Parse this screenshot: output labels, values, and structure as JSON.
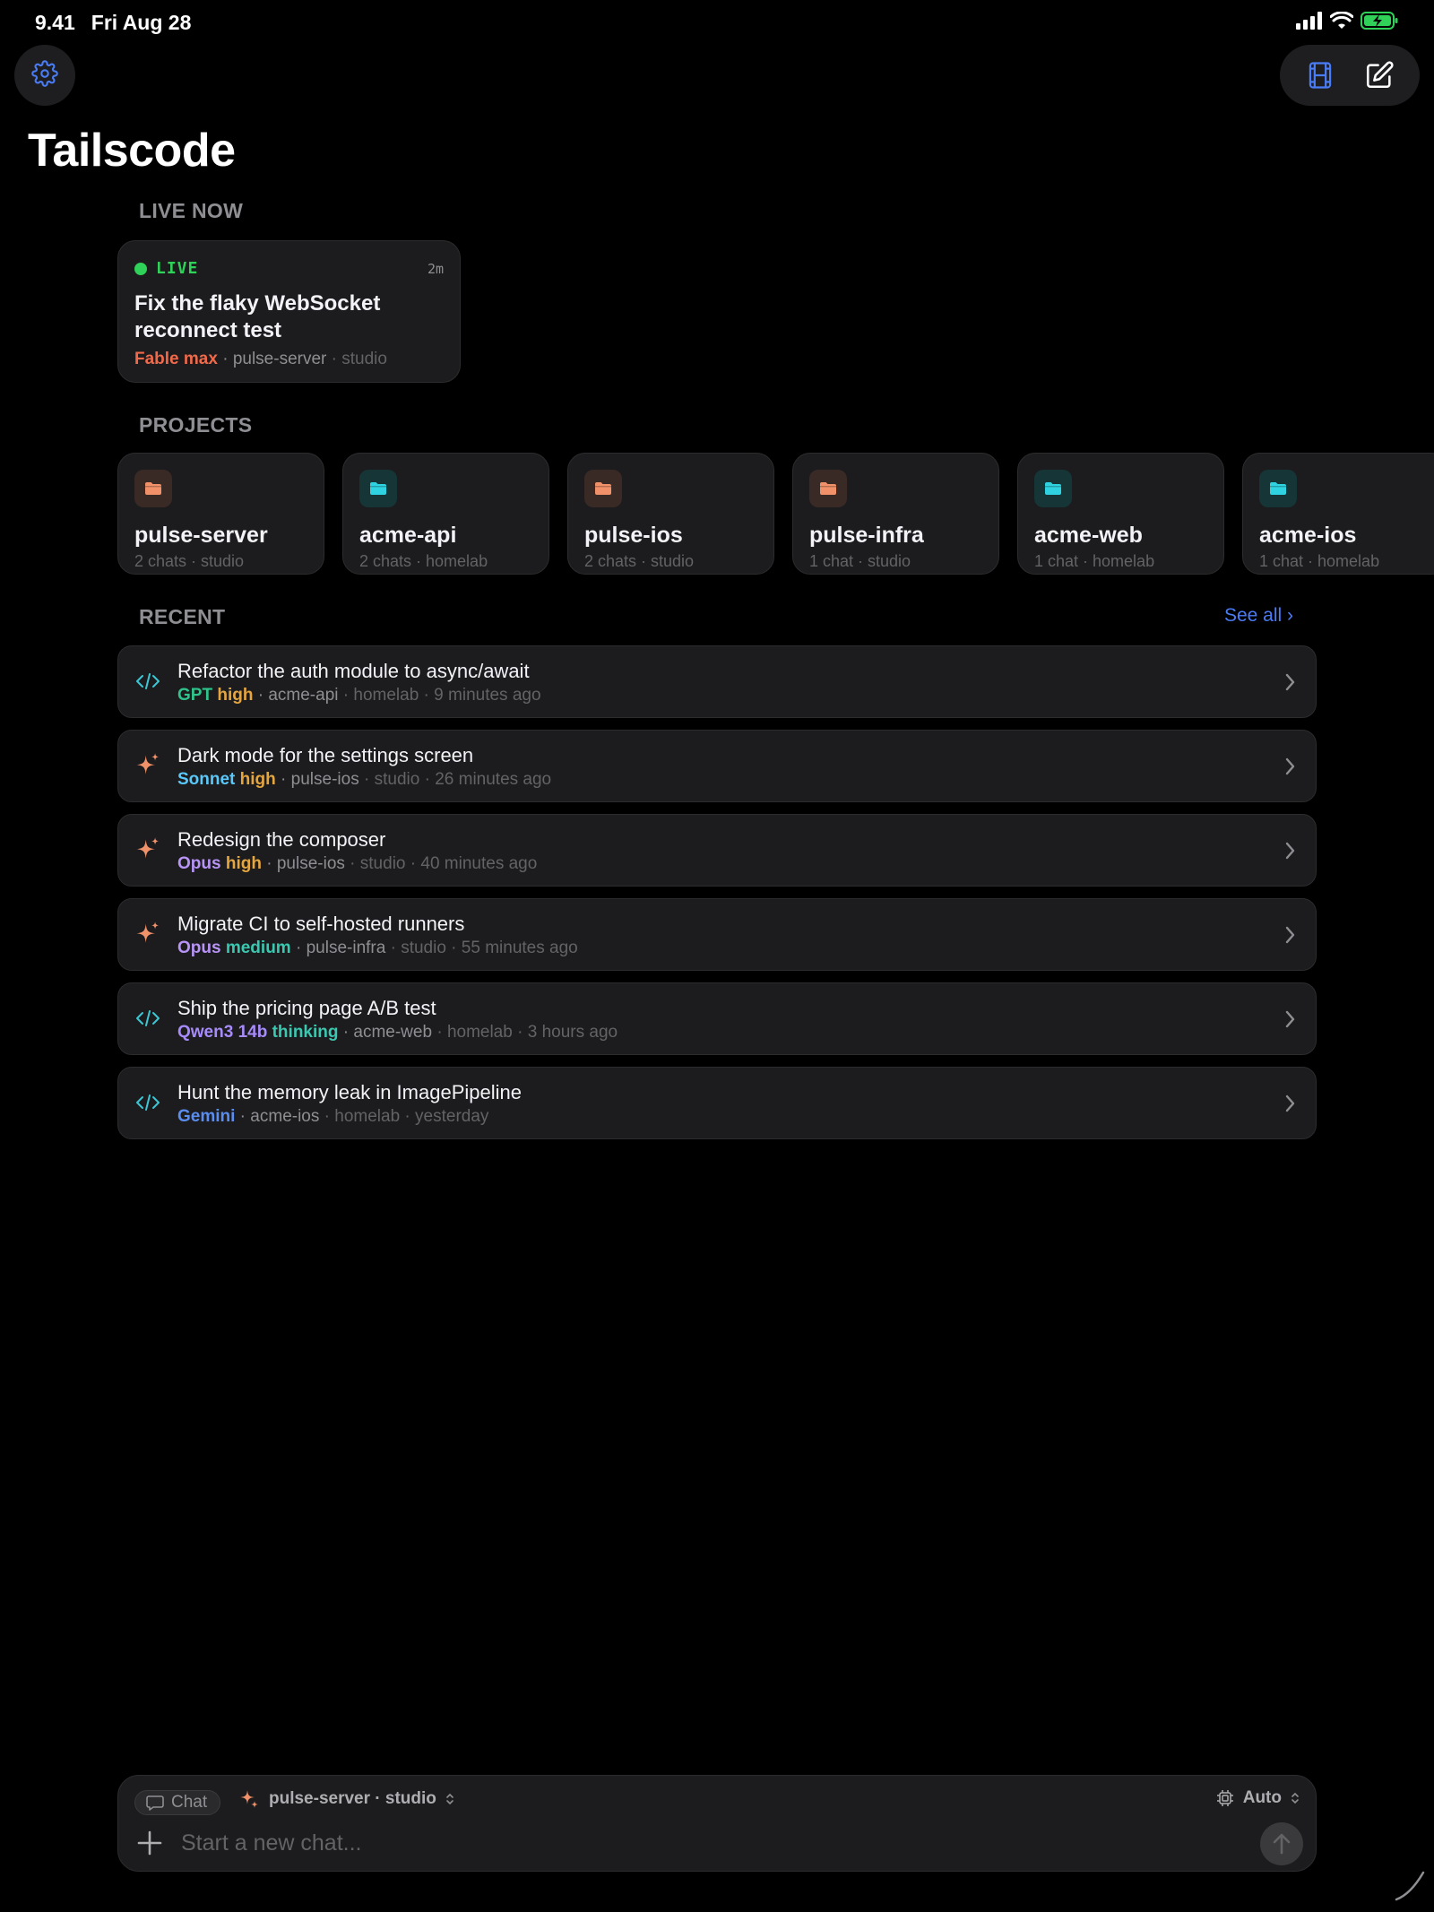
{
  "status_bar": {
    "time": "9.41",
    "date": "Fri Aug 28"
  },
  "app": {
    "title": "Tailscode"
  },
  "sections": {
    "live_now": "LIVE NOW",
    "projects": "PROJECTS",
    "recent": "RECENT",
    "see_all": "See all ›"
  },
  "live_session": {
    "badge": "LIVE",
    "elapsed": "2m",
    "title": "Fix the flaky WebSocket reconnect test",
    "model": "Fable max",
    "project": "pulse-server",
    "host": "studio"
  },
  "projects": [
    {
      "name": "pulse-server",
      "meta": "2 chats · studio",
      "color": "#f0916a",
      "tone": "orange"
    },
    {
      "name": "acme-api",
      "meta": "2 chats · homelab",
      "color": "#2fd2e0",
      "tone": "teal"
    },
    {
      "name": "pulse-ios",
      "meta": "2 chats · studio",
      "color": "#f0916a",
      "tone": "orange"
    },
    {
      "name": "pulse-infra",
      "meta": "1 chat · studio",
      "color": "#f0916a",
      "tone": "orange"
    },
    {
      "name": "acme-web",
      "meta": "1 chat · homelab",
      "color": "#2fd2e0",
      "tone": "teal"
    },
    {
      "name": "acme-ios",
      "meta": "1 chat · homelab",
      "color": "#2fd2e0",
      "tone": "teal"
    }
  ],
  "recent": [
    {
      "icon": "code-icon",
      "title": "Refactor the auth module to async/await",
      "model": "GPT",
      "model_color": "c-green",
      "effort": "high",
      "effort_color": "c-orange",
      "project": "acme-api",
      "host": "homelab",
      "time": "9 minutes ago"
    },
    {
      "icon": "sparkle-icon",
      "title": "Dark mode for the settings screen",
      "model": "Sonnet",
      "model_color": "c-blue",
      "effort": "high",
      "effort_color": "c-orange",
      "project": "pulse-ios",
      "host": "studio",
      "time": "26 minutes ago"
    },
    {
      "icon": "sparkle-icon",
      "title": "Redesign the composer",
      "model": "Opus",
      "model_color": "c-purple",
      "effort": "high",
      "effort_color": "c-orange",
      "project": "pulse-ios",
      "host": "studio",
      "time": "40 minutes ago"
    },
    {
      "icon": "sparkle-icon",
      "title": "Migrate CI to self-hosted runners",
      "model": "Opus",
      "model_color": "c-purple",
      "effort": "medium",
      "effort_color": "c-teal",
      "project": "pulse-infra",
      "host": "studio",
      "time": "55 minutes ago"
    },
    {
      "icon": "code-icon",
      "title": "Ship the pricing page A/B test",
      "model": "Qwen3 14b",
      "model_color": "c-indigo",
      "effort": "thinking",
      "effort_color": "c-teal",
      "project": "acme-web",
      "host": "homelab",
      "time": "3 hours ago"
    },
    {
      "icon": "code-icon",
      "title": "Hunt the memory leak in ImagePipeline",
      "model": "Gemini",
      "model_color": "c-geminiblue",
      "effort": "",
      "effort_color": "",
      "project": "acme-ios",
      "host": "homelab",
      "time": "yesterday"
    }
  ],
  "composer": {
    "mode": "Chat",
    "project_host": "pulse-server · studio",
    "model": "Auto",
    "placeholder": "Start a new chat..."
  }
}
